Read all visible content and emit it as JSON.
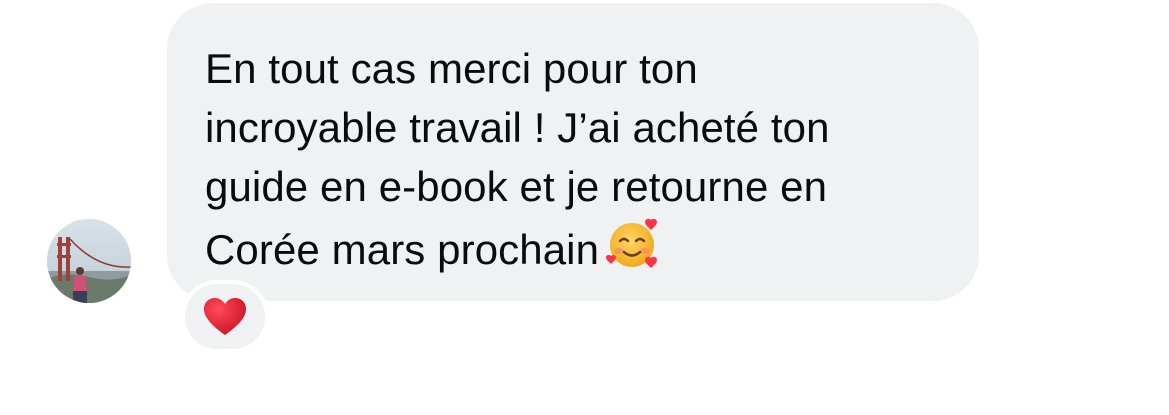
{
  "conversation": {
    "sender_avatar_icon": "profile-photo-avatar",
    "message": {
      "lines": [
        "En tout cas merci pour ton",
        "incroyable travail ! J’ai acheté ton",
        "guide en e-book et je retourne en",
        "Corée mars prochain"
      ],
      "trailing_emoji": "smiling-face-with-hearts-icon"
    },
    "reaction": {
      "emoji": "red-heart-icon"
    }
  },
  "colors": {
    "bubble_background": "#eff1f3",
    "text": "#0b0b0b",
    "heart": "#e0152a",
    "page_background": "#ffffff"
  }
}
